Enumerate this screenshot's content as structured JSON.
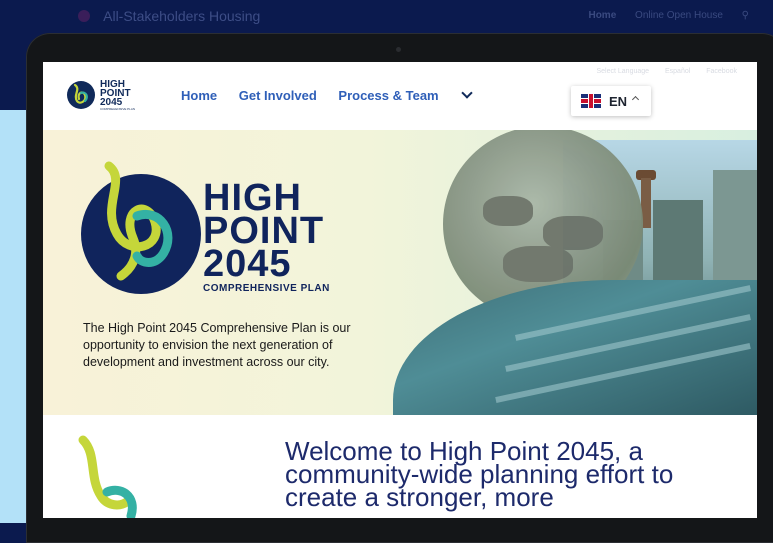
{
  "outer_nav": {
    "brand": "All-Stakeholders Housing",
    "links": [
      "Home",
      "Online Open House"
    ]
  },
  "site_header": {
    "logo": {
      "line1": "HIGH",
      "line2": "POINT",
      "line3": "2045",
      "line4": "COMPREHENSIVE PLAN"
    },
    "nav": {
      "home": "Home",
      "get_involved": "Get Involved",
      "process_team": "Process & Team"
    },
    "faint_links": [
      "Select Language",
      "Español",
      "Facebook"
    ],
    "language": {
      "code": "EN"
    }
  },
  "hero": {
    "title_line1": "HIGH",
    "title_line2": "POINT",
    "title_line3": "2045",
    "subtitle": "COMPREHENSIVE PLAN",
    "description": "The High Point 2045 Comprehensive Plan is our opportunity to envision the next generation of development and investment across our city."
  },
  "welcome": {
    "text": "Welcome to High Point 2045, a community-wide planning effort to create a stronger, more"
  },
  "colors": {
    "navy": "#10245c",
    "nav_blue": "#2f5fb8",
    "outer_bg": "#0b1a4e",
    "side_light": "#b3e1f8",
    "lime": "#c5d63a",
    "teal": "#34b1a4"
  },
  "icons": [
    "search-icon",
    "chevron-down-icon",
    "uk-flag-icon",
    "caret-up-icon",
    "camera-dot"
  ]
}
